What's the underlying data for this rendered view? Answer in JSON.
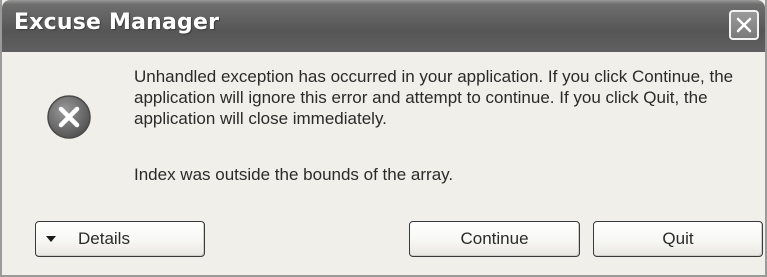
{
  "window": {
    "title": "Excuse Manager",
    "close_icon": "close-icon"
  },
  "message": {
    "icon": "error-icon",
    "text": "Unhandled exception has occurred in your application. If you click Continue, the application will ignore this error and attempt to continue. If you click Quit, the application will close immediately.",
    "detail": "Index was outside the bounds of the array."
  },
  "buttons": {
    "details_label": "Details",
    "details_icon": "chevron-down-icon",
    "continue_label": "Continue",
    "quit_label": "Quit"
  },
  "colors": {
    "titlebar": "#5d5d5d",
    "title_text": "#ffffff",
    "dialog_bg": "#f0efe9",
    "error_icon": "#6a6a6a"
  }
}
